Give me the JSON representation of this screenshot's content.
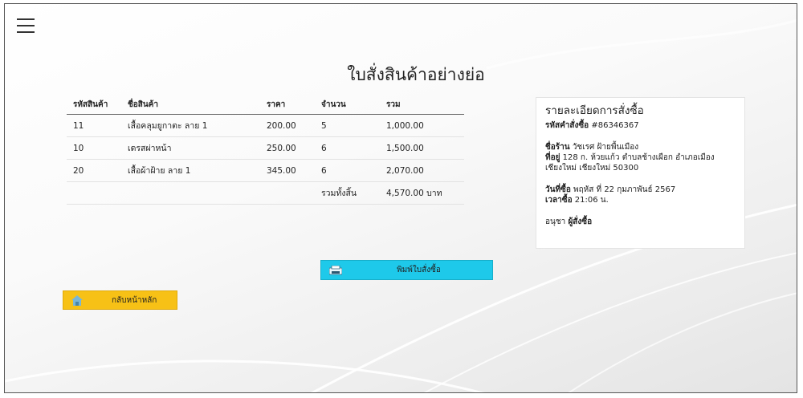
{
  "page": {
    "title": "ใบสั่งสินค้าอย่างย่อ"
  },
  "table": {
    "headers": [
      "รหัสสินค้า",
      "ชื่อสินค้า",
      "ราคา",
      "จำนวน",
      "รวม"
    ],
    "rows": [
      [
        "11",
        "เสื้อคลุมยูกาตะ ลาย 1",
        "200.00",
        "5",
        "1,000.00"
      ],
      [
        "10",
        "เดรสผ่าหน้า",
        "250.00",
        "6",
        "1,500.00"
      ],
      [
        "20",
        "เสื้อผ้าฝ้าย ลาย 1",
        "345.00",
        "6",
        "2,070.00"
      ]
    ],
    "total_label": "รวมทั้งสิ้น",
    "total_value": "4,570.00 บาท"
  },
  "order": {
    "heading": "รายละเอียดการสั่งซื้อ",
    "code_label": "รหัสคำสั่งซื้อ",
    "code_value": "#86346367",
    "shop_label": "ชื่อร้าน",
    "shop_value": "วัชเรศ ฝ้ายพื้นเมือง",
    "address_label": "ที่อยู่",
    "address_value": "128 ก. ห้วยแก้ว ตำบลช้างเผือก อำเภอเมือง",
    "address_line2": "เชียงใหม่ เชียงใหม่ 50300",
    "date_label": "วันที่ซื้อ",
    "date_value": "พฤหัส ที่ 22 กุมภาพันธ์ 2567",
    "time_label": "เวลาซื้อ",
    "time_value": "21:06 น.",
    "buyer_name": "อนุชา",
    "buyer_label": "ผู้สั่งซื้อ"
  },
  "buttons": {
    "print": "พิมพ์ใบสั่งซื้อ",
    "home": "กลับหน้าหลัก"
  },
  "icons": {
    "menu": "hamburger-icon",
    "print": "printer-icon",
    "home": "home-icon"
  },
  "colors": {
    "print_button": "#1ec9ea",
    "home_button": "#f7c116"
  }
}
